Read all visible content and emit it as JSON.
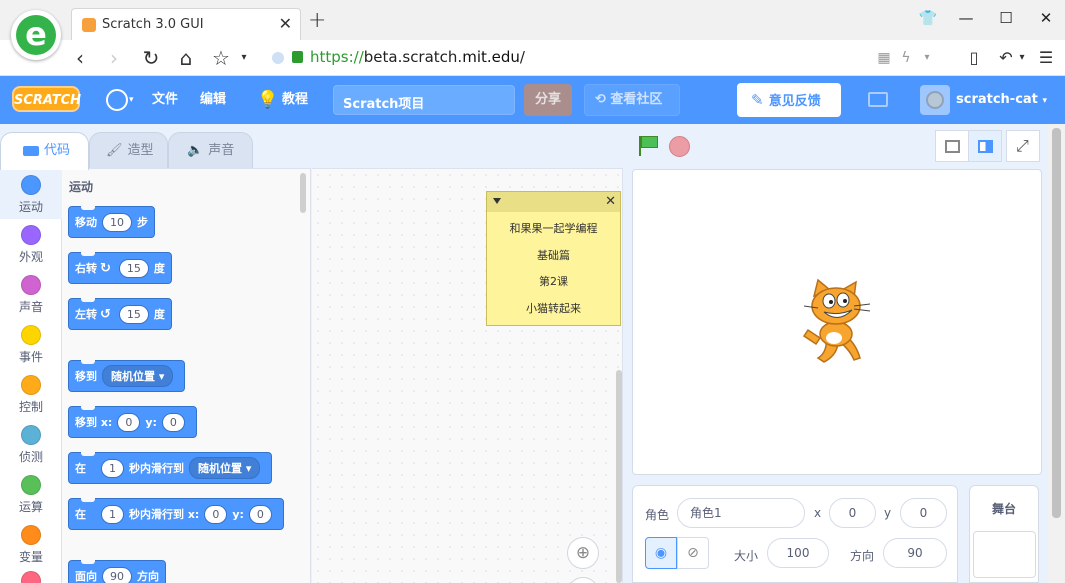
{
  "browser": {
    "tab_title": "Scratch 3.0 GUI",
    "url_scheme": "https://",
    "url_sub": "beta.scratch.",
    "url_host": "mit.edu",
    "url_path": "/"
  },
  "menu": {
    "logo": "SCRATCH",
    "file": "文件",
    "edit": "编辑",
    "tutorials": "教程",
    "project_title": "Scratch项目",
    "share": "分享",
    "see_community": "查看社区",
    "feedback": "意见反馈",
    "username": "scratch-cat"
  },
  "tabs": [
    "代码",
    "造型",
    "声音"
  ],
  "categories": [
    {
      "label": "运动",
      "color": "#4c97ff"
    },
    {
      "label": "外观",
      "color": "#9966ff"
    },
    {
      "label": "声音",
      "color": "#cf63cf"
    },
    {
      "label": "事件",
      "color": "#ffd500"
    },
    {
      "label": "控制",
      "color": "#ffab19"
    },
    {
      "label": "侦测",
      "color": "#5cb1d6"
    },
    {
      "label": "运算",
      "color": "#59c059"
    },
    {
      "label": "变量",
      "color": "#ff8c1a"
    }
  ],
  "palette": {
    "section_title": "运动",
    "move": {
      "a": "移动",
      "n": "10",
      "b": "步"
    },
    "turn_right": {
      "a": "右转",
      "n": "15",
      "b": "度"
    },
    "turn_left": {
      "a": "左转",
      "n": "15",
      "b": "度"
    },
    "goto_menu": {
      "a": "移到",
      "opt": "随机位置"
    },
    "goto_xy": {
      "a": "移到 x:",
      "x": "0",
      "b": "y:",
      "y": "0"
    },
    "glide_menu": {
      "a": "在",
      "n": "1",
      "b": "秒内滑行到",
      "opt": "随机位置"
    },
    "glide_xy": {
      "a": "在",
      "n": "1",
      "b": "秒内滑行到 x:",
      "x": "0",
      "c": "y:",
      "y": "0"
    },
    "point": {
      "a": "面向",
      "n": "90",
      "b": "方向"
    }
  },
  "note": {
    "lines": [
      "和果果一起学编程",
      "基础篇",
      "第2课",
      "小猫转起来"
    ]
  },
  "sprite_info": {
    "sprite_label": "角色",
    "sprite_name": "角色1",
    "x_label": "x",
    "x": "0",
    "y_label": "y",
    "y": "0",
    "size_label": "大小",
    "size": "100",
    "direction_label": "方向",
    "direction": "90"
  },
  "stage_pane": {
    "title": "舞台"
  }
}
